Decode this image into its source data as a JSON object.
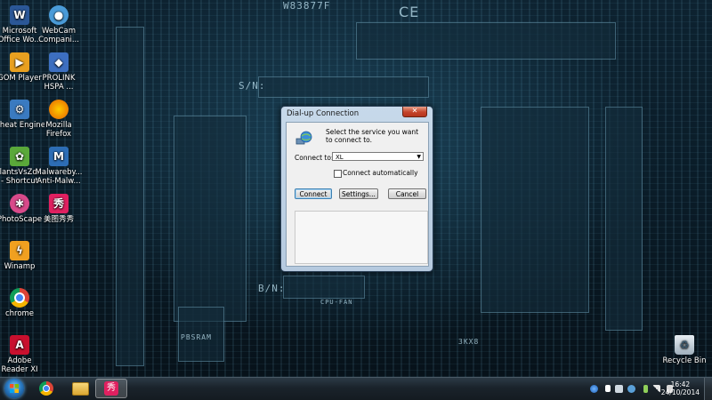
{
  "desktop": {
    "wallpaper_labels": [
      "W83877F",
      "S/N:",
      "B/N:",
      "CPU-FAN",
      "PBSRAM",
      "3KX8"
    ],
    "icons": [
      {
        "label": "Microsoft Office Wo...",
        "icon": "word-icon",
        "color": "#2b5797"
      },
      {
        "label": "WebCam Compani...",
        "icon": "webcam-icon",
        "color": "#4a9bd8"
      },
      {
        "label": "GOM Player",
        "icon": "gom-player-icon",
        "color": "#e8a020"
      },
      {
        "label": "PROLINK HSPA ...",
        "icon": "prolink-icon",
        "color": "#3d6fc0"
      },
      {
        "label": "Cheat Engine",
        "icon": "cheat-engine-icon",
        "color": "#3a7ac0"
      },
      {
        "label": "Mozilla Firefox",
        "icon": "firefox-icon",
        "color": "#e66000"
      },
      {
        "label": "PlantsVsZo... - Shortcut",
        "icon": "plants-vs-zombies-icon",
        "color": "#5aa83a"
      },
      {
        "label": "Malwareby... Anti-Malw...",
        "icon": "malwarebytes-icon",
        "color": "#2d6db5"
      },
      {
        "label": "PhotoScape",
        "icon": "photoscape-icon",
        "color": "#d84a8a"
      },
      {
        "label": "美图秀秀",
        "icon": "meitu-icon",
        "color": "#e02060"
      },
      {
        "label": "Winamp",
        "icon": "winamp-icon",
        "color": "#f0a020"
      },
      {
        "label": "chrome",
        "icon": "chrome-icon",
        "color": "#db4437"
      },
      {
        "label": "Adobe Reader XI",
        "icon": "adobe-reader-icon",
        "color": "#c8102e"
      },
      {
        "label": "Recycle Bin",
        "icon": "recycle-bin-icon",
        "color": "#c9d6e0"
      }
    ]
  },
  "dialog": {
    "title": "Dial-up Connection",
    "close_glyph": "✕",
    "prompt": "Select the service you want to connect to.",
    "connect_to_label": "Connect to:",
    "connect_to_value": "XL",
    "connect_auto_label": "Connect automatically",
    "connect_auto_checked": false,
    "buttons": {
      "connect": "Connect",
      "settings": "Settings...",
      "cancel": "Cancel"
    }
  },
  "taskbar": {
    "pinned": [
      {
        "icon": "chrome-icon"
      },
      {
        "icon": "file-explorer-icon"
      },
      {
        "icon": "meitu-icon",
        "active": true
      }
    ],
    "tray_icons": [
      "network-globe-icon",
      "flag-icon",
      "app-icon",
      "camera-icon",
      "battery-icon",
      "signal-icon",
      "volume-icon"
    ],
    "time": "16:42",
    "date": "24/10/2014"
  }
}
